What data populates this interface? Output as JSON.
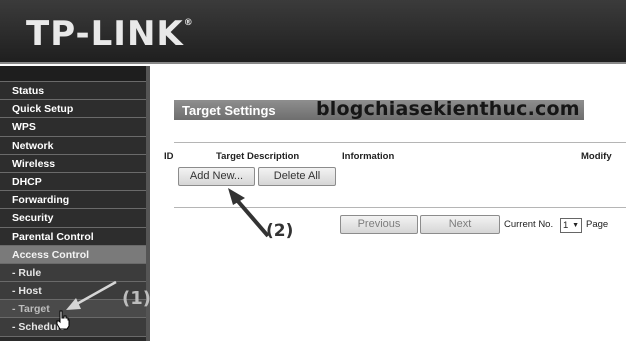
{
  "header": {
    "logo": "TP-LINK",
    "logo_mark": "®"
  },
  "sidebar": {
    "items": [
      {
        "label": "Status"
      },
      {
        "label": "Quick Setup"
      },
      {
        "label": "WPS"
      },
      {
        "label": "Network"
      },
      {
        "label": "Wireless"
      },
      {
        "label": "DHCP"
      },
      {
        "label": "Forwarding"
      },
      {
        "label": "Security"
      },
      {
        "label": "Parental Control"
      },
      {
        "label": "Access Control"
      },
      {
        "label": "- Rule"
      },
      {
        "label": "- Host"
      },
      {
        "label": "- Target"
      },
      {
        "label": "- Schedule"
      }
    ]
  },
  "main": {
    "title": "Target Settings",
    "watermark": "blogchiasekienthuc.com",
    "columns": {
      "id": "ID",
      "description": "Target Description",
      "information": "Information",
      "modify": "Modify"
    },
    "buttons": {
      "add_new": "Add New...",
      "delete_all": "Delete All",
      "previous": "Previous",
      "next": "Next"
    },
    "pager": {
      "current_label": "Current No.",
      "current_value": "1",
      "page_label": "Page"
    }
  },
  "annotations": {
    "step1": "(1)",
    "step2": "(2)"
  }
}
